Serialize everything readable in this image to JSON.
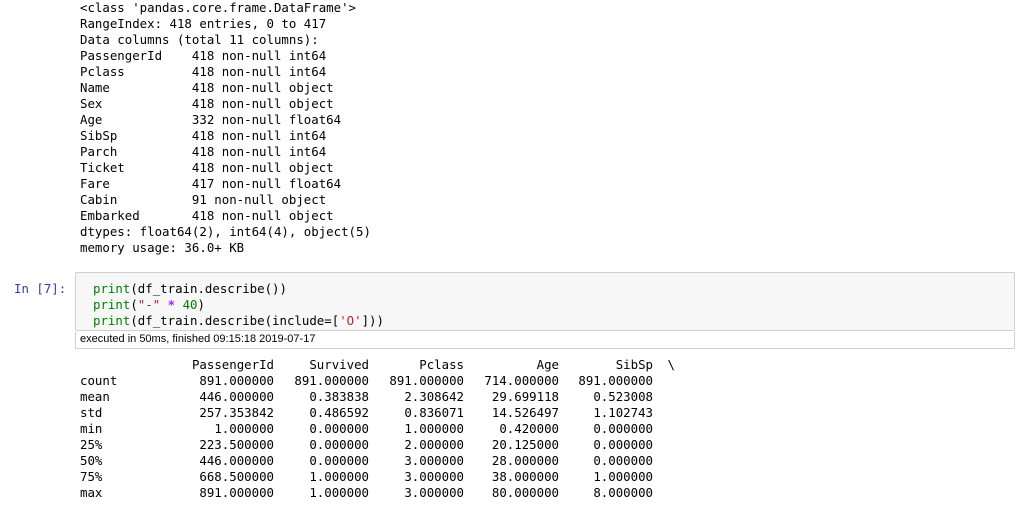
{
  "info_output": {
    "lines": [
      "<class 'pandas.core.frame.DataFrame'>",
      "RangeIndex: 418 entries, 0 to 417",
      "Data columns (total 11 columns):",
      "PassengerId    418 non-null int64",
      "Pclass         418 non-null int64",
      "Name           418 non-null object",
      "Sex            418 non-null object",
      "Age            332 non-null float64",
      "SibSp          418 non-null int64",
      "Parch          418 non-null int64",
      "Ticket         418 non-null object",
      "Fare           417 non-null float64",
      "Cabin          91 non-null object",
      "Embarked       418 non-null object",
      "dtypes: float64(2), int64(4), object(5)",
      "memory usage: 36.0+ KB"
    ]
  },
  "cell": {
    "prompt": "In [7]:",
    "code": {
      "line1": {
        "fn": "print",
        "rest": "(df_train.describe())"
      },
      "line2": {
        "fn": "print",
        "open": "(",
        "str": "\"-\"",
        "op": " * ",
        "num": "40",
        "close": ")"
      },
      "line3": {
        "fn": "print",
        "open": "(df_train.describe(include=[",
        "str": "'O'",
        "close": "]))"
      }
    },
    "execution_info": "executed in 50ms, finished 09:15:18 2019-07-17"
  },
  "describe_output": {
    "columns": [
      "PassengerId",
      "Survived",
      "Pclass",
      "Age",
      "SibSp",
      "\\"
    ],
    "rows": [
      {
        "index": "count",
        "values": [
          "891.000000",
          "891.000000",
          "891.000000",
          "714.000000",
          "891.000000"
        ]
      },
      {
        "index": "mean",
        "values": [
          "446.000000",
          "0.383838",
          "2.308642",
          "29.699118",
          "0.523008"
        ]
      },
      {
        "index": "std",
        "values": [
          "257.353842",
          "0.486592",
          "0.836071",
          "14.526497",
          "1.102743"
        ]
      },
      {
        "index": "min",
        "values": [
          "1.000000",
          "0.000000",
          "1.000000",
          "0.420000",
          "0.000000"
        ]
      },
      {
        "index": "25%",
        "values": [
          "223.500000",
          "0.000000",
          "2.000000",
          "20.125000",
          "0.000000"
        ]
      },
      {
        "index": "50%",
        "values": [
          "446.000000",
          "0.000000",
          "3.000000",
          "28.000000",
          "0.000000"
        ]
      },
      {
        "index": "75%",
        "values": [
          "668.500000",
          "1.000000",
          "3.000000",
          "38.000000",
          "1.000000"
        ]
      },
      {
        "index": "max",
        "values": [
          "891.000000",
          "1.000000",
          "3.000000",
          "80.000000",
          "8.000000"
        ]
      }
    ]
  },
  "colors": {
    "prompt": "#303f9f",
    "builtin": "#008000",
    "string": "#ba2121",
    "operator": "#aa22ff",
    "cell_bg": "#f7f7f7",
    "cell_border": "#cfcfcf"
  }
}
